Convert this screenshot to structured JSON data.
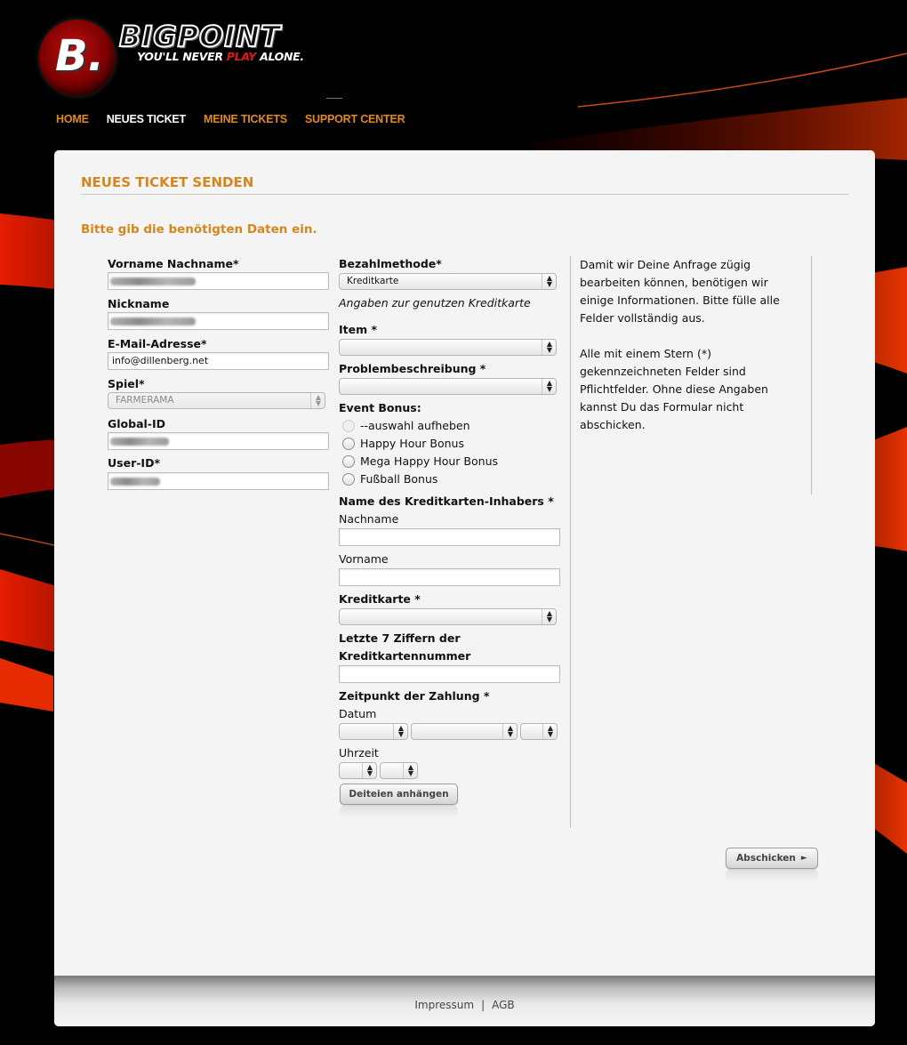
{
  "brand": {
    "letter": "B.",
    "name": "BIGPOINT",
    "tagline_pre": "YOU'LL NEVER ",
    "tagline_play": "PLAY",
    "tagline_post": " ALONE."
  },
  "nav": {
    "items": [
      {
        "label": "HOME",
        "active": false
      },
      {
        "label": "NEUES TICKET",
        "active": true
      },
      {
        "label": "MEINE TICKETS",
        "active": false
      },
      {
        "label": "SUPPORT CENTER",
        "active": false
      }
    ]
  },
  "page": {
    "title": "NEUES TICKET SENDEN",
    "intro": "Bitte gib die benötigten Daten ein."
  },
  "left_form": {
    "name_label": "Vorname Nachname*",
    "nickname_label": "Nickname",
    "email_label": "E-Mail-Adresse*",
    "email_value": "info@dillenberg.net",
    "game_label": "Spiel*",
    "game_value": "FARMERAMA",
    "global_id_label": "Global-ID",
    "user_id_label": "User-ID*"
  },
  "mid_form": {
    "payment_label": "Bezahlmethode*",
    "payment_value": "Kreditkarte",
    "card_info_note": "Angaben zur genutzen Kreditkarte",
    "item_label": "Item *",
    "problem_label": "Problembeschreibung *",
    "event_bonus_label": "Event Bonus:",
    "bonus_options": [
      "--auswahl aufheben",
      "Happy Hour Bonus",
      "Mega Happy Hour Bonus",
      "Fußball Bonus"
    ],
    "holder_label": "Name des Kreditkarten-Inhabers *",
    "lastname_label": "Nachname",
    "firstname_label": "Vorname",
    "card_label": "Kreditkarte *",
    "digits_label_1": "Letzte 7 Ziffern der",
    "digits_label_2": "Kreditkartennummer",
    "payment_time_label": "Zeitpunkt der Zahlung *",
    "date_label": "Datum",
    "time_label": "Uhrzeit",
    "attach_button": "Deiteien anhängen"
  },
  "help": {
    "para1": "Damit wir Deine Anfrage zügig bearbeiten können, benötigen wir einige Informationen. Bitte fülle alle Felder vollständig aus.",
    "para2": "Alle mit einem Stern (*) gekennzeichneten Felder sind Pflichtfelder. Ohne diese Angaben kannst Du das Formular nicht abschicken."
  },
  "submit_button": "Abschicken",
  "submit_arrow": "►",
  "footer": {
    "impressum": "Impressum",
    "separator": "|",
    "agb": "AGB"
  },
  "colors": {
    "accent": "#d4871e",
    "nav_active": "#ffffff",
    "nav": "#e08a1e",
    "panel_bg": "#f4f4f4",
    "page_bg": "#000000",
    "streak": "#ff1a00"
  }
}
